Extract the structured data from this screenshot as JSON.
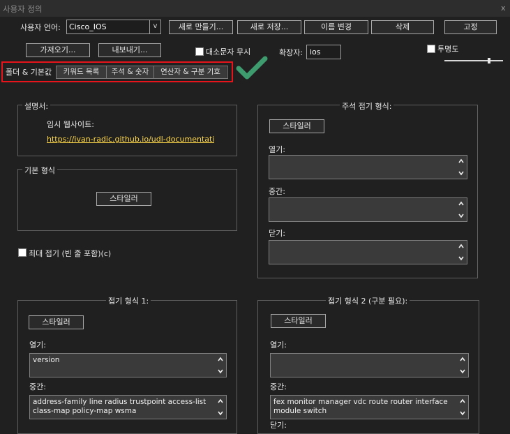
{
  "window": {
    "title": "사용자 정의",
    "close_label": "x"
  },
  "language": {
    "label": "사용자 언어:",
    "selected": "Cisco_IOS",
    "arrow": "v"
  },
  "toolbar": {
    "new_label": "새로 만들기...",
    "save_as_label": "새로 저장...",
    "rename_label": "이름 변경",
    "delete_label": "삭제",
    "pin_label": "고정",
    "import_label": "가져오기...",
    "export_label": "내보내기..."
  },
  "ignore_case": {
    "label": "대소문자 무시",
    "checked": false
  },
  "extension": {
    "label": "확장자:",
    "value": "ios"
  },
  "transparency": {
    "label": "투명도",
    "checked": false,
    "level": 0.77
  },
  "tabs": [
    "폴더 & 기본값",
    "키워드 목록",
    "주석 & 숫자",
    "연산자 & 구분 기호"
  ],
  "annotation": {
    "highlight_color": "#e8141c",
    "check_color": "#3d9b6e"
  },
  "docs": {
    "group_title": "설명서:",
    "temp_site_label": "임시 웹사이트:",
    "url": "https://ivan-radic.github.io/udl-documentation/"
  },
  "default_style": {
    "group_title": "기본 형식",
    "styler_label": "스타일러"
  },
  "fold_compact": {
    "label": "최대 접기 (빈 줄 포함)(c)",
    "checked": false
  },
  "comment_fold": {
    "group_title": "주석 접기 형식:",
    "styler_label": "스타일러",
    "open_label": "열기:",
    "open_value": "",
    "middle_label": "중간:",
    "middle_value": "",
    "close_label": "닫기:",
    "close_value": ""
  },
  "fold1": {
    "group_title": "접기 형식 1:",
    "styler_label": "스타일러",
    "open_label": "열기:",
    "open_value": "version",
    "middle_label": "중간:",
    "middle_value": "address-family line radius trustpoint access-list class-map policy-map wsma"
  },
  "fold2": {
    "group_title": "접기 형식 2 (구분 필요):",
    "styler_label": "스타일러",
    "open_label": "열기:",
    "open_value": "",
    "middle_label": "중간:",
    "middle_value": "fex monitor manager vdc route router interface module switch",
    "close_label": "닫기:"
  },
  "icons": {
    "scroll_up": "chevron-up-icon",
    "scroll_down": "chevron-down-icon",
    "check": "checkmark-icon"
  }
}
